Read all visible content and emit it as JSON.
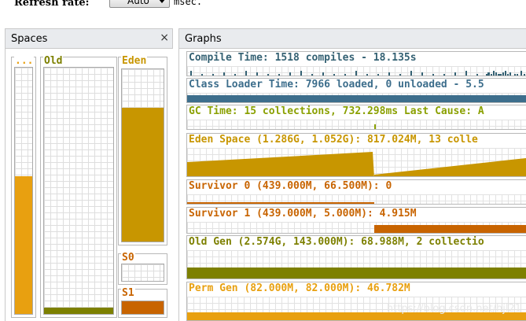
{
  "toolbar": {
    "refresh_label": "Refresh rate:",
    "refresh_value": "Auto",
    "unit": "msec."
  },
  "spaces_panel": {
    "title": "Spaces",
    "close": "×",
    "spaces": [
      {
        "key": "perm",
        "label": "...",
        "fill": 0.56,
        "color": "#e8a010"
      },
      {
        "key": "old",
        "label": "Old",
        "fill": 0.027,
        "color": "#7d8000"
      },
      {
        "key": "eden",
        "label": "Eden",
        "fill": 0.777,
        "color": "#c89600"
      },
      {
        "key": "s0",
        "label": "S0",
        "fill": 0.0,
        "color": "#c86400"
      },
      {
        "key": "s1",
        "label": "S1",
        "fill": 0.98,
        "color": "#c86400"
      }
    ]
  },
  "graphs_panel": {
    "title": "Graphs",
    "graphs": [
      {
        "key": "compile",
        "title": "Compile Time: 1518 compiles - 18.135s",
        "color": "#346173"
      },
      {
        "key": "classloader",
        "title": "Class Loader Time: 7966 loaded, 0 unloaded - 5.5",
        "color": "#3d6e8c"
      },
      {
        "key": "gc",
        "title": "GC Time: 15 collections, 732.298ms Last Cause: A",
        "color": "#8aa000"
      },
      {
        "key": "eden",
        "title": "Eden Space (1.286G, 1.052G): 817.024M, 13 colle",
        "color": "#c89600"
      },
      {
        "key": "s0",
        "title": "Survivor 0 (439.000M, 66.500M): 0",
        "color": "#c86400"
      },
      {
        "key": "s1",
        "title": "Survivor 1 (439.000M, 5.000M): 4.915M",
        "color": "#c86400"
      },
      {
        "key": "old",
        "title": "Old Gen (2.574G, 143.000M): 68.988M, 2 collectio",
        "color": "#7d8000"
      },
      {
        "key": "perm",
        "title": "Perm Gen (82.000M, 82.000M): 46.782M",
        "color": "#e8a010"
      }
    ]
  },
  "watermark": "https://blog.csdn.net/hjl21"
}
